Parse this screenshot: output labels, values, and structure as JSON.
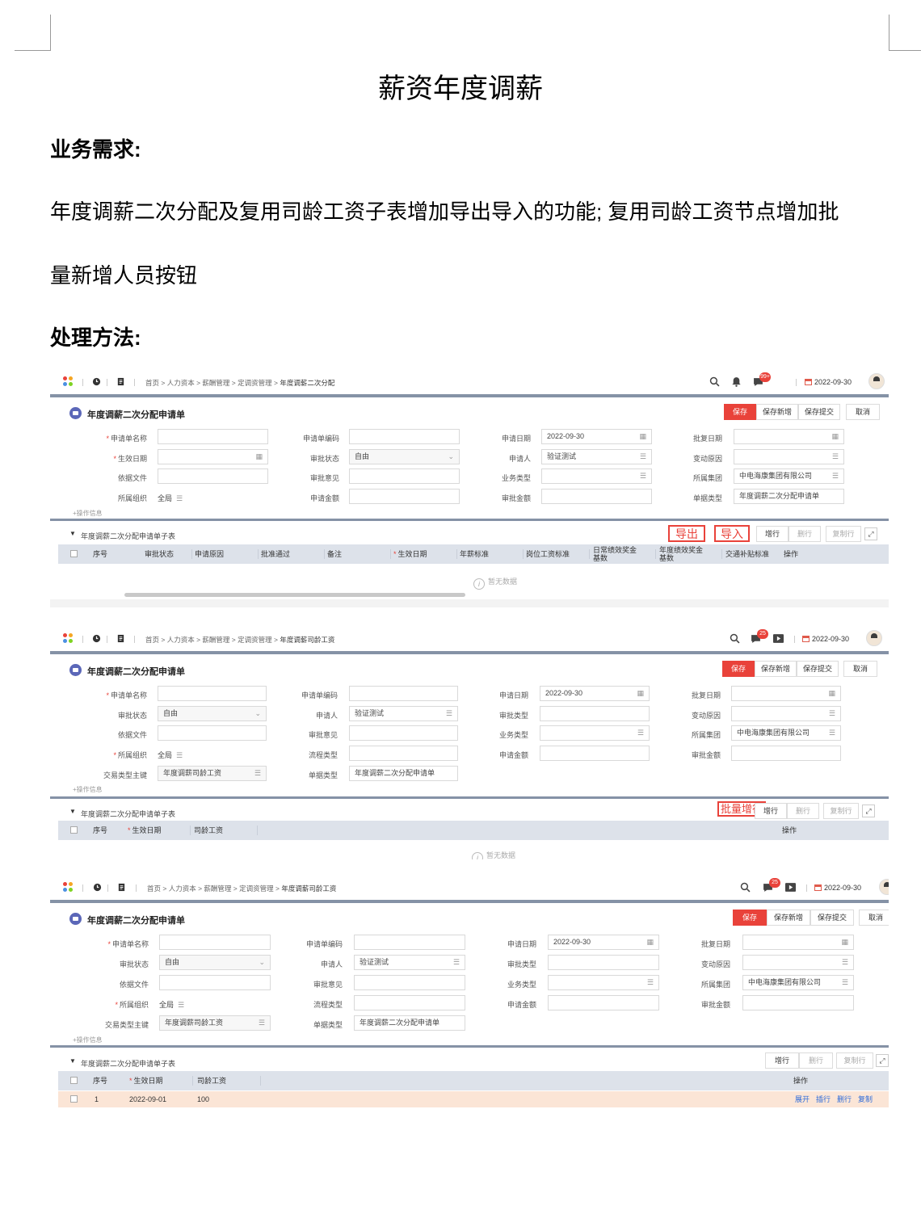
{
  "doc": {
    "title": "薪资年度调薪",
    "req_heading": "业务需求:",
    "req_line1": "年度调薪二次分配及复用司龄工资子表增加导出导入的功能; 复用司龄工资节点增加批",
    "req_line2": "量新增人员按钮",
    "method_heading": "处理方法:"
  },
  "colors": {
    "primary": "#e9423a",
    "header_band": "#8592a6",
    "grid_header": "#dde2ea",
    "row_highlight": "#fbe5d6",
    "link": "#2f6bd8"
  },
  "screens": [
    {
      "breadcrumb": [
        "首页",
        "人力资本",
        "薪酬管理",
        "定调资管理"
      ],
      "breadcrumb_current": "年度调薪二次分配",
      "badge": "99+",
      "date": "2022-09-30",
      "form_title": "年度调薪二次分配申请单",
      "buttons": {
        "save": "保存",
        "save_new": "保存新增",
        "save_submit": "保存提交",
        "cancel": "取消"
      },
      "labels": {
        "name": "申请单名称",
        "code": "申请单编码",
        "apply_date": "申请日期",
        "approve_date": "批复日期",
        "effective_date": "生效日期",
        "approve_status": "审批状态",
        "applicant": "申请人",
        "change_reason": "变动原因",
        "basis_file": "依据文件",
        "approve_opinion": "审批意见",
        "biz_type": "业务类型",
        "group": "所属集团",
        "org": "所属组织",
        "apply_amount": "申请金额",
        "approve_amount": "审批金额",
        "bill_type": "单据类型"
      },
      "values": {
        "apply_date": "2022-09-30",
        "approve_status": "自由",
        "applicant": "验证测试",
        "group": "中电海康集团有限公司",
        "org": "全局",
        "bill_type": "年度调薪二次分配申请单"
      },
      "op_info": "+操作信息",
      "sub_title": "年度调薪二次分配申请单子表",
      "export_label": "导出",
      "import_label": "导入",
      "grid_buttons": {
        "add_row": "增行",
        "del_row": "删行",
        "copy_row": "复制行"
      },
      "columns": [
        "序号",
        "审批状态",
        "申请原因",
        "批准通过",
        "备注",
        "生效日期",
        "年薪标准",
        "岗位工资标准",
        "日常绩效奖金基数",
        "年度绩效奖金基数",
        "交通补贴标准",
        "操作"
      ],
      "no_data": "暂无数据"
    },
    {
      "breadcrumb": [
        "首页",
        "人力资本",
        "薪酬管理",
        "定调资管理"
      ],
      "breadcrumb_current": "年度调薪司龄工资",
      "badge": "25",
      "date": "2022-09-30",
      "form_title": "年度调薪二次分配申请单",
      "buttons": {
        "save": "保存",
        "save_new": "保存新增",
        "save_submit": "保存提交",
        "cancel": "取消"
      },
      "labels": {
        "name": "申请单名称",
        "code": "申请单编码",
        "apply_date": "申请日期",
        "approve_date": "批复日期",
        "approve_status": "审批状态",
        "applicant": "申请人",
        "approve_type": "审批类型",
        "change_reason": "变动原因",
        "basis_file": "依据文件",
        "approve_opinion": "审批意见",
        "biz_type": "业务类型",
        "group": "所属集团",
        "org": "所属组织",
        "flow_type": "流程类型",
        "apply_amount": "申请金额",
        "approve_amount": "审批金额",
        "trade_key": "交易类型主键",
        "bill_type": "单据类型"
      },
      "values": {
        "apply_date": "2022-09-30",
        "approve_status": "自由",
        "applicant": "验证测试",
        "group": "中电海康集团有限公司",
        "org": "全局",
        "trade_key": "年度调薪司龄工资",
        "bill_type": "年度调薪二次分配申请单"
      },
      "op_info": "+操作信息",
      "sub_title": "年度调薪二次分配申请单子表",
      "batch_add_label": "批量增行",
      "grid_buttons": {
        "add_row": "增行",
        "del_row": "删行",
        "copy_row": "复制行"
      },
      "columns": [
        "序号",
        "生效日期",
        "司龄工资",
        "操作"
      ],
      "no_data": "暂无数据"
    },
    {
      "breadcrumb": [
        "首页",
        "人力资本",
        "薪酬管理",
        "定调资管理"
      ],
      "breadcrumb_current": "年度调薪司龄工资",
      "badge": "25",
      "date": "2022-09-30",
      "form_title": "年度调薪二次分配申请单",
      "buttons": {
        "save": "保存",
        "save_new": "保存新增",
        "save_submit": "保存提交",
        "cancel": "取消"
      },
      "labels": {
        "name": "申请单名称",
        "code": "申请单编码",
        "apply_date": "申请日期",
        "approve_date": "批复日期",
        "approve_status": "审批状态",
        "applicant": "申请人",
        "approve_type": "审批类型",
        "change_reason": "变动原因",
        "basis_file": "依据文件",
        "approve_opinion": "审批意见",
        "biz_type": "业务类型",
        "group": "所属集团",
        "org": "所属组织",
        "flow_type": "流程类型",
        "apply_amount": "申请金额",
        "approve_amount": "审批金额",
        "trade_key": "交易类型主键",
        "bill_type": "单据类型"
      },
      "values": {
        "apply_date": "2022-09-30",
        "approve_status": "自由",
        "applicant": "验证测试",
        "group": "中电海康集团有限公司",
        "org": "全局",
        "trade_key": "年度调薪司龄工资",
        "bill_type": "年度调薪二次分配申请单"
      },
      "op_info": "+操作信息",
      "sub_title": "年度调薪二次分配申请单子表",
      "grid_buttons": {
        "add_row": "增行",
        "del_row": "删行",
        "copy_row": "复制行"
      },
      "columns": [
        "序号",
        "生效日期",
        "司龄工资",
        "操作"
      ],
      "rows": [
        {
          "index": "1",
          "effective_date": "2022-09-01",
          "seniority_wage": "100"
        }
      ],
      "row_actions": [
        "展开",
        "插行",
        "删行",
        "复制"
      ]
    }
  ]
}
